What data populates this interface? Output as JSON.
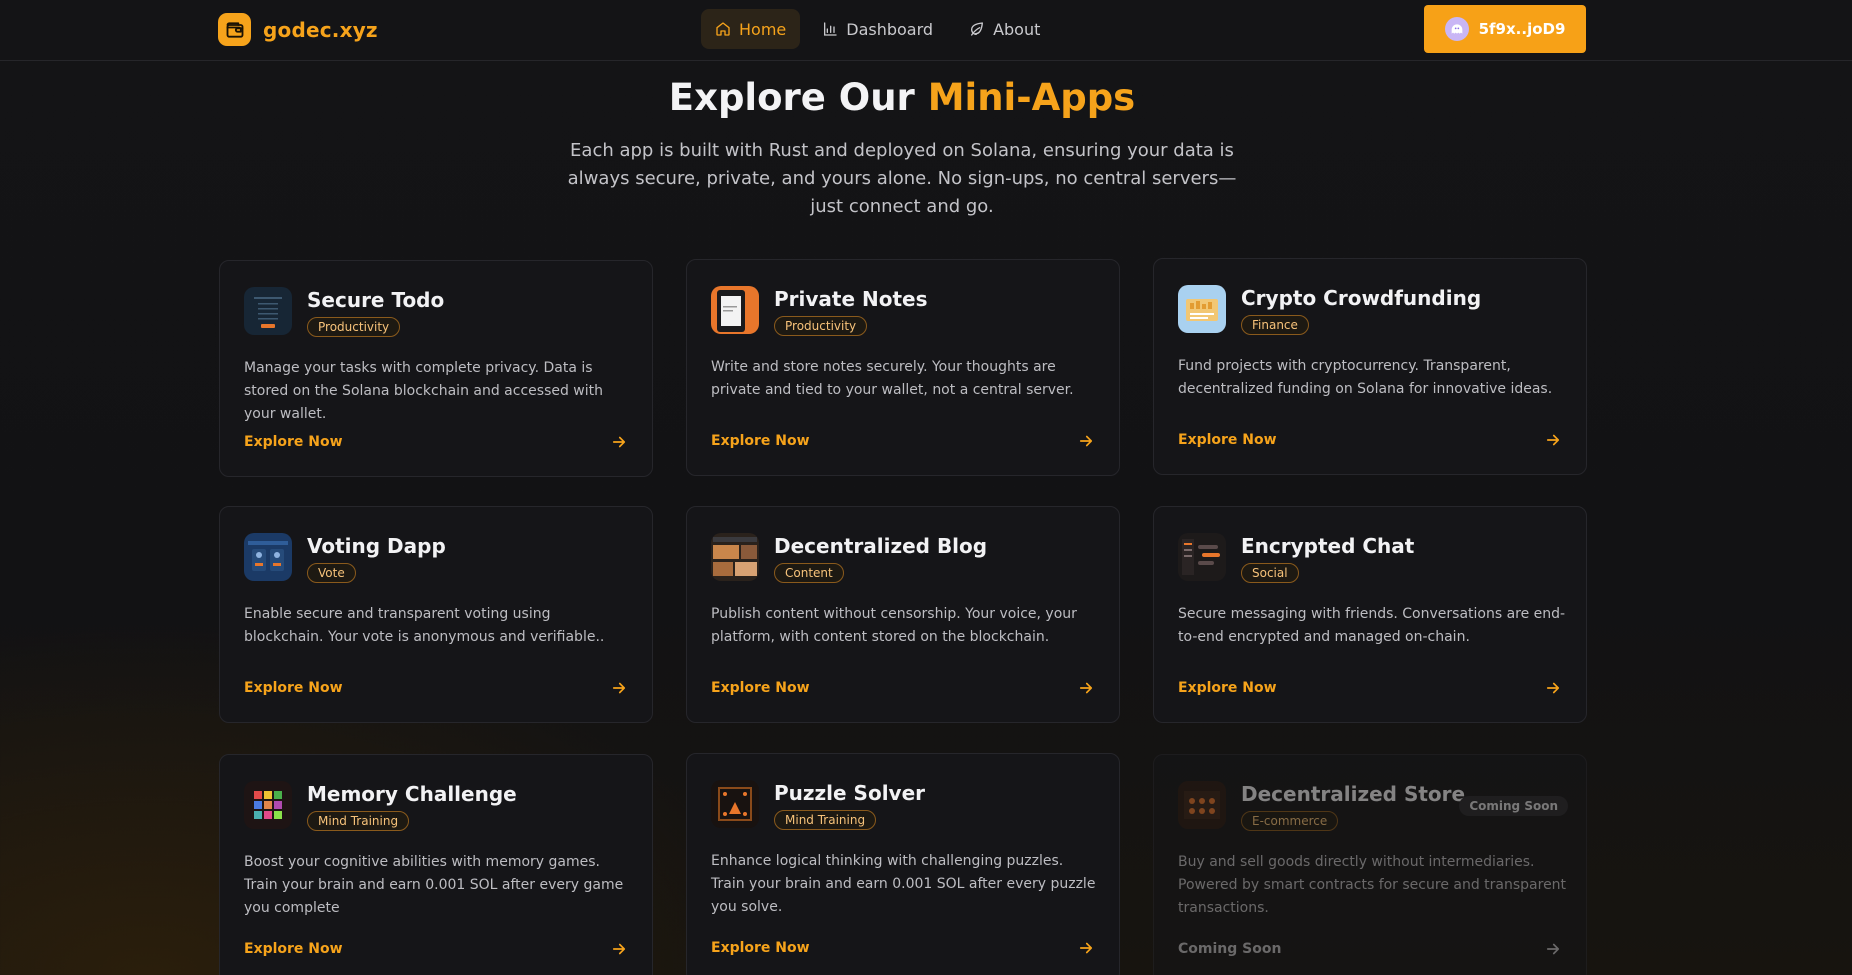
{
  "brand": {
    "name": "godec.xyz",
    "logo_icon": "wallet-icon",
    "accent": "#f6a31b"
  },
  "nav": {
    "items": [
      {
        "label": "Home",
        "icon": "home-icon",
        "active": true
      },
      {
        "label": "Dashboard",
        "icon": "bar-chart-icon",
        "active": false
      },
      {
        "label": "About",
        "icon": "leaf-icon",
        "active": false
      }
    ]
  },
  "wallet": {
    "label": "5f9x..joD9",
    "icon": "phantom-ghost-icon",
    "color": "#f7a117"
  },
  "hero": {
    "title_prefix": "Explore Our",
    "title_accent": "Mini-Apps",
    "subtitle": "Each app is built with Rust and deployed on Solana, ensuring your data is always secure, private, and yours alone. No sign-ups, no central servers—just connect and go."
  },
  "apps": [
    {
      "title": "Secure Todo",
      "tag": "Productivity",
      "description": "Manage your tasks with complete privacy. Data is stored on the Solana blockchain and accessed with your wallet.",
      "cta": "Explore Now"
    },
    {
      "title": "Private Notes",
      "tag": "Productivity",
      "description": "Write and store notes securely. Your thoughts are private and tied to your wallet, not a central server.",
      "cta": "Explore Now"
    },
    {
      "title": "Crypto Crowdfunding",
      "tag": "Finance",
      "description": "Fund projects with cryptocurrency. Transparent, decentralized funding on Solana for innovative ideas.",
      "cta": "Explore Now"
    },
    {
      "title": "Voting Dapp",
      "tag": "Vote",
      "description": "Enable secure and transparent voting using blockchain. Your vote is anonymous and verifiable..",
      "cta": "Explore Now"
    },
    {
      "title": "Decentralized Blog",
      "tag": "Content",
      "description": "Publish content without censorship. Your voice, your platform, with content stored on the blockchain.",
      "cta": "Explore Now"
    },
    {
      "title": "Encrypted Chat",
      "tag": "Social",
      "description": "Secure messaging with friends. Conversations are end-to-end encrypted and managed on-chain.",
      "cta": "Explore Now"
    },
    {
      "title": "Memory Challenge",
      "tag": "Mind Training",
      "description": "Boost your cognitive abilities with memory games. Train your brain and earn 0.001 SOL after every game you complete",
      "cta": "Explore Now"
    },
    {
      "title": "Puzzle Solver",
      "tag": "Mind Training",
      "description": "Enhance logical thinking with challenging puzzles. Train your brain and earn 0.001 SOL after every puzzle you solve.",
      "cta": "Explore Now"
    },
    {
      "title": "Decentralized Store",
      "tag": "E-commerce",
      "description": "Buy and sell goods directly without intermediaries. Powered by smart contracts for secure and transparent transactions.",
      "cta": "Coming Soon",
      "badge": "Coming Soon"
    }
  ]
}
